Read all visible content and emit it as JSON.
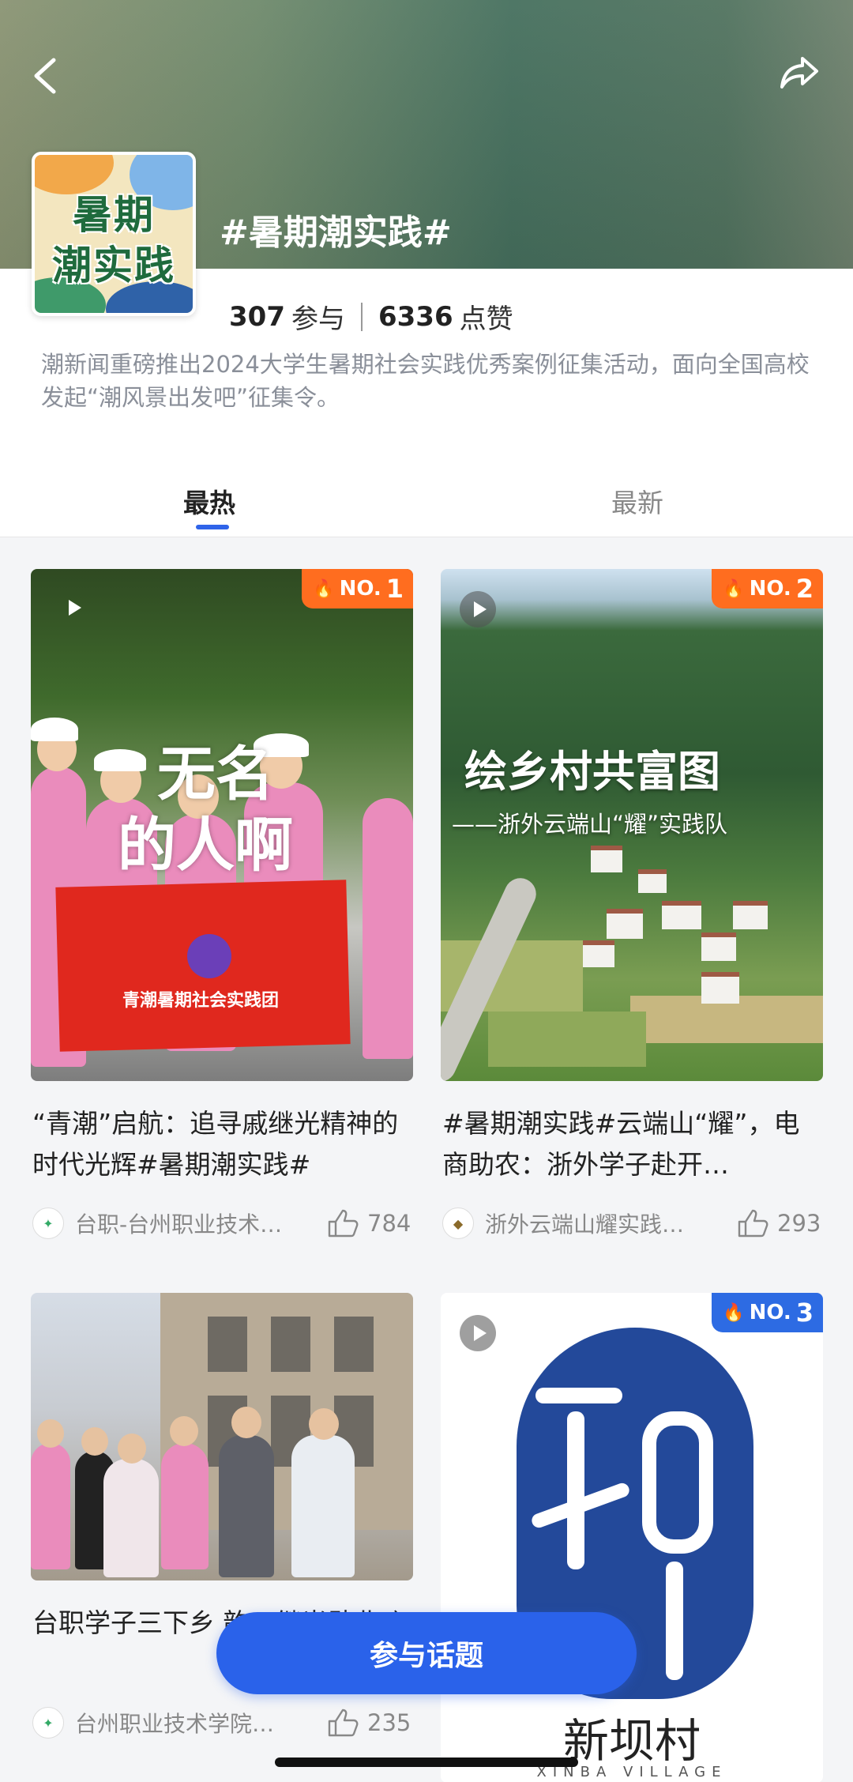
{
  "header": {
    "cover_line1": "暑期",
    "cover_line2": "潮实践",
    "topic_title": "#暑期潮实践#"
  },
  "stats": {
    "participants": "307",
    "participants_label": "参与",
    "likes": "6336",
    "likes_label": "点赞"
  },
  "description": "潮新闻重磅推出2024大学生暑期社会实践优秀案例征集活动，面向全国高校发起“潮风景出发吧”征集令。",
  "tabs": [
    {
      "label": "最热",
      "active": true
    },
    {
      "label": "最新",
      "active": false
    }
  ],
  "cards": [
    {
      "rank_prefix": "NO.",
      "rank_num": "1",
      "overlay_line1": "无名",
      "overlay_line2": "的人啊",
      "banner_text": "青潮暑期社会实践团",
      "title": "“青潮”启航：追寻戚继光精神的时代光辉#暑期潮实践#",
      "author": "台职-台州职业技术…",
      "likes": "784"
    },
    {
      "rank_prefix": "NO.",
      "rank_num": "2",
      "overlay_title": "绘乡村共富图",
      "overlay_sub": "——浙外云端山“耀”实践队",
      "title": "#暑期潮实践#云端山“耀”，电商助农：浙外学子赴开…",
      "author": "浙外云端山耀实践…",
      "likes": "293"
    },
    {
      "title": "台职学子三下乡 韵，继光勋业吣",
      "author": "台州职业技术学院…",
      "likes": "235"
    },
    {
      "rank_prefix": "NO.",
      "rank_num": "3",
      "logo_name": "新坝村",
      "logo_sub": "XINBA VILLAGE"
    }
  ],
  "cta_label": "参与话题",
  "colors": {
    "accent": "#2a62ea",
    "rank_orange": "#ff6d1f",
    "rank_blue": "#2d6be3"
  }
}
